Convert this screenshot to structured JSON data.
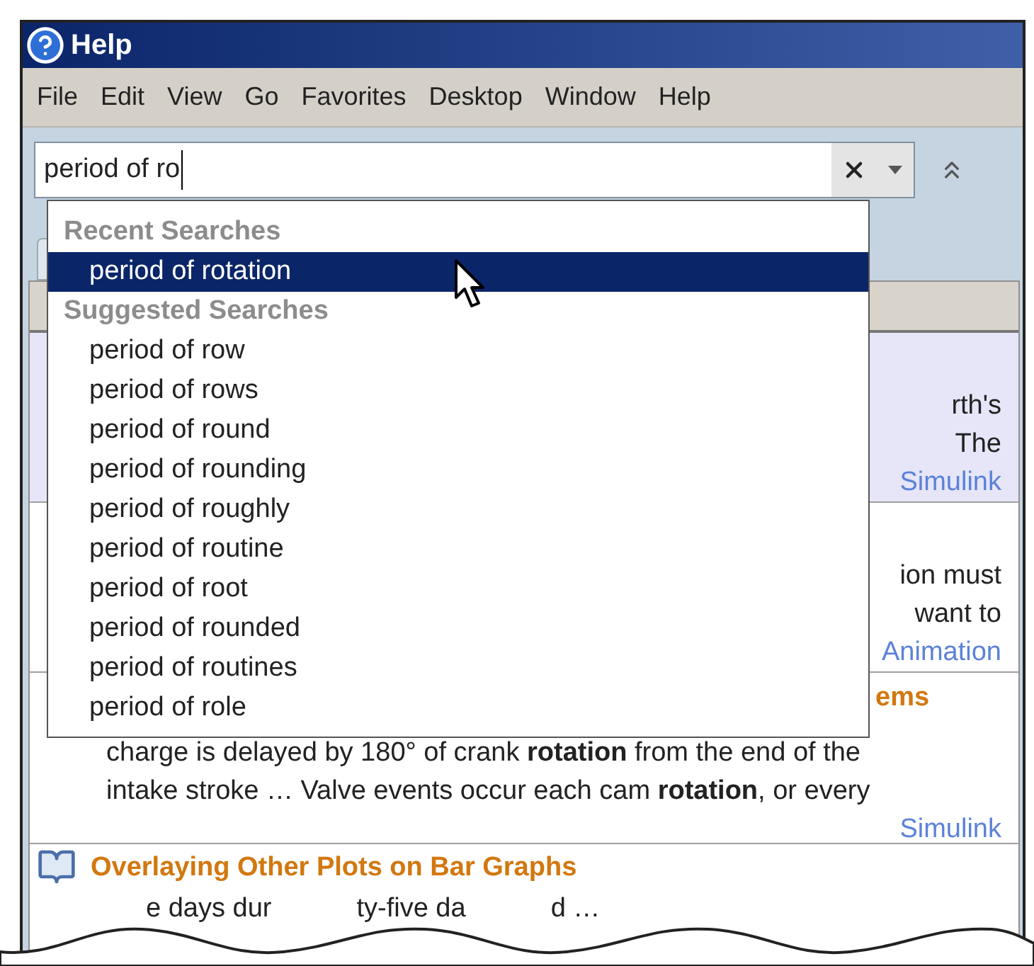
{
  "window": {
    "title": "Help"
  },
  "menu": [
    "File",
    "Edit",
    "View",
    "Go",
    "Favorites",
    "Desktop",
    "Window",
    "Help"
  ],
  "search": {
    "value": "period of ro"
  },
  "suggestions": [
    {
      "heading": "Recent Searches",
      "items": [
        {
          "label": "period of rotation",
          "selected": true
        }
      ]
    },
    {
      "heading": "Suggested Searches",
      "items": [
        {
          "label": "period of row",
          "selected": false
        },
        {
          "label": "period of rows",
          "selected": false
        },
        {
          "label": "period of round",
          "selected": false
        },
        {
          "label": "period of rounding",
          "selected": false
        },
        {
          "label": "period of roughly",
          "selected": false
        },
        {
          "label": "period of routine",
          "selected": false
        },
        {
          "label": "period of root",
          "selected": false
        },
        {
          "label": "period of rounded",
          "selected": false
        },
        {
          "label": "period of routines",
          "selected": false
        },
        {
          "label": "period of role",
          "selected": false
        }
      ]
    }
  ],
  "results": [
    {
      "kind": "partial",
      "selected": true,
      "lines": [
        "rth's",
        "The"
      ],
      "product": "Simulink"
    },
    {
      "kind": "partial",
      "selected": false,
      "lines": [
        "ion must",
        "want to"
      ],
      "product": "Animation"
    },
    {
      "kind": "full",
      "selected": false,
      "title": "ems",
      "lines": [
        "charge is delayed by 180° of crank **rotation** from the end of the",
        "intake stroke … Valve events occur each cam **rotation**, or every"
      ],
      "product": "Simulink"
    },
    {
      "kind": "torn",
      "selected": false,
      "title": "Overlaying Other Plots on Bar Graphs",
      "fragments": [
        "e days dur",
        "ty-five da",
        "d …"
      ]
    }
  ]
}
